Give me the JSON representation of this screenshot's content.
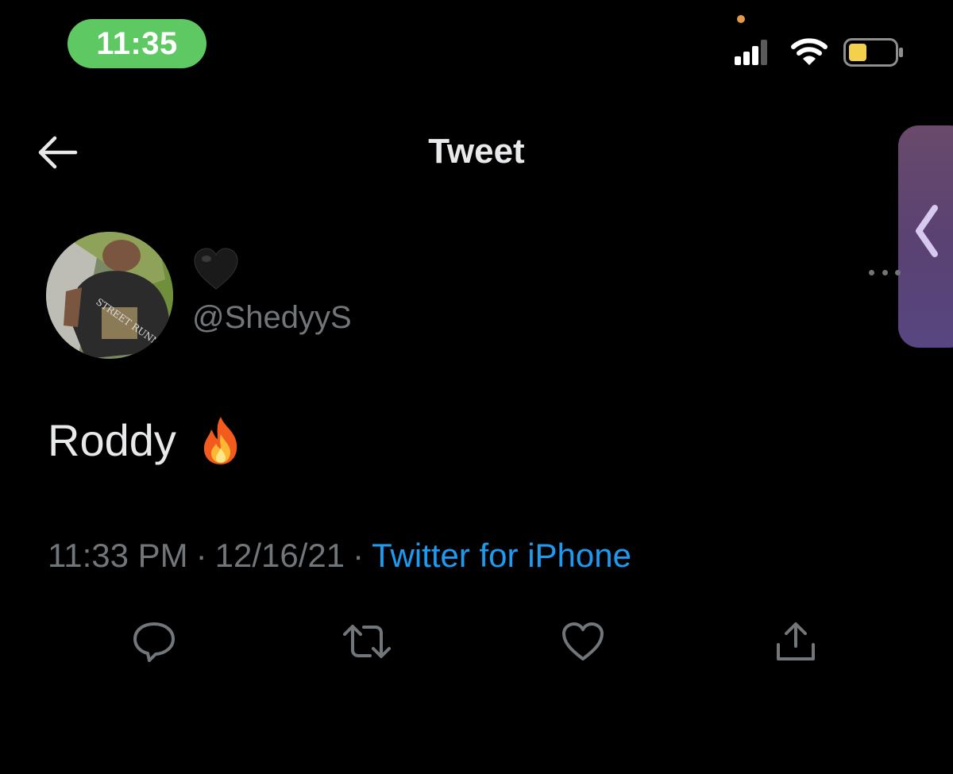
{
  "status_bar": {
    "time": "11:35",
    "time_pill_color": "#5ec863",
    "icons": [
      "privacy-dot",
      "cellular-signal-icon",
      "wifi-icon",
      "battery-icon"
    ],
    "battery_level": 0.35,
    "battery_color": "#f4d14a"
  },
  "header": {
    "back_icon": "arrow-left-icon",
    "title": "Tweet"
  },
  "tweet": {
    "author": {
      "display_name_icon": "black-heart-emoji",
      "handle": "@ShedyyS"
    },
    "text": "Roddy",
    "text_emoji": "fire-emoji",
    "time": "11:33 PM",
    "date": "12/16/21",
    "separator": "·",
    "source": "Twitter for iPhone",
    "more_icon": "more-dots-icon"
  },
  "actions": [
    {
      "name": "reply",
      "icon": "reply-icon"
    },
    {
      "name": "retweet",
      "icon": "retweet-icon"
    },
    {
      "name": "like",
      "icon": "heart-icon"
    },
    {
      "name": "share",
      "icon": "share-icon"
    }
  ],
  "colors": {
    "background": "#000000",
    "primary_text": "#e7e9ea",
    "secondary_text": "#71767b",
    "link": "#1d9bf0",
    "side_handle": "#5a4272"
  }
}
